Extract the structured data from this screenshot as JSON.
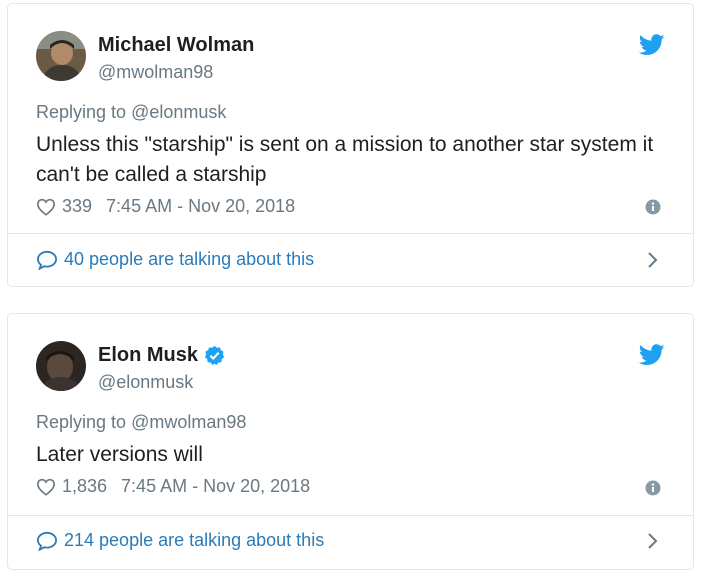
{
  "colors": {
    "text": "#1c2022",
    "secondary": "#697882",
    "link": "#2b7bb9",
    "twitter_blue": "#1da1f2",
    "border": "#e1e8ed"
  },
  "tweets": [
    {
      "name": "Michael Wolman",
      "handle": "@mwolman98",
      "verified": false,
      "replying_prefix": "Replying to ",
      "replying_to": "@elonmusk",
      "text": "Unless this \"starship\" is sent on a mission to another star system it can't be called a starship",
      "likes": "339",
      "timestamp": "7:45 AM - Nov 20, 2018",
      "talking": "40 people are talking about this",
      "icons": [
        "avatar",
        "twitter-bird-icon",
        "heart-icon",
        "info-icon",
        "speech-bubble-icon",
        "chevron-right-icon"
      ]
    },
    {
      "name": "Elon Musk",
      "handle": "@elonmusk",
      "verified": true,
      "replying_prefix": "Replying to ",
      "replying_to": "@mwolman98",
      "text": "Later versions will",
      "likes": "1,836",
      "timestamp": "7:45 AM - Nov 20, 2018",
      "talking": "214 people are talking about this",
      "icons": [
        "avatar",
        "verified-badge-icon",
        "twitter-bird-icon",
        "heart-icon",
        "info-icon",
        "speech-bubble-icon",
        "chevron-right-icon"
      ]
    }
  ]
}
